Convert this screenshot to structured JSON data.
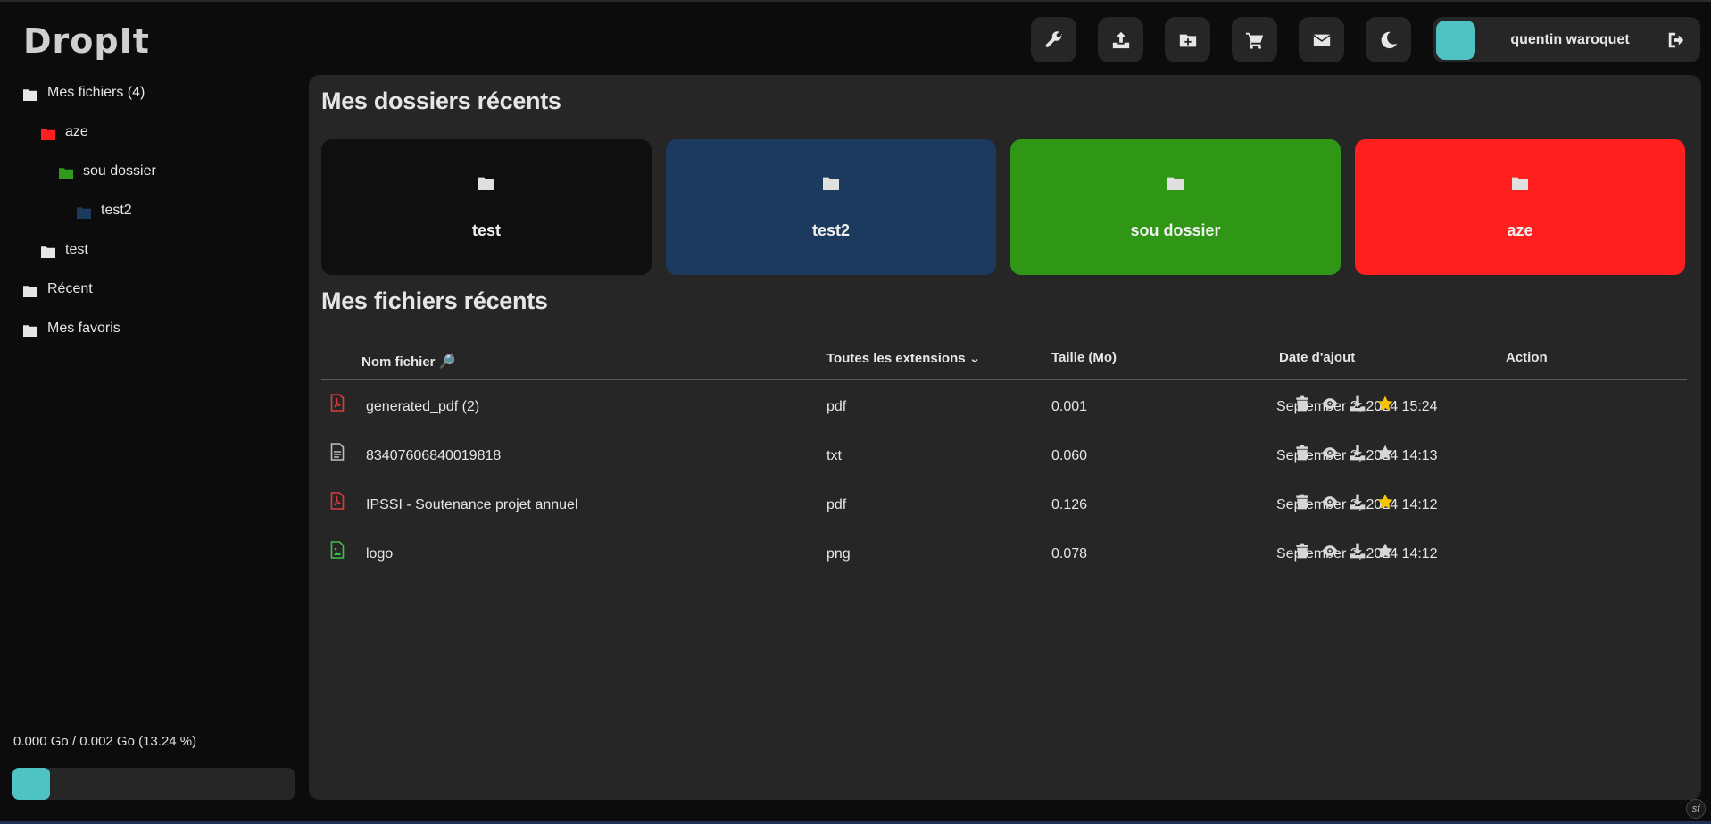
{
  "app": {
    "logo": "DropIt"
  },
  "sidebar": {
    "tree": [
      {
        "label": "Mes fichiers (4)",
        "color": "#e6e6e6",
        "indent": 0
      },
      {
        "label": "aze",
        "color": "#ff1f1f",
        "indent": 1
      },
      {
        "label": "sou dossier",
        "color": "#2f9a1b",
        "indent": 2
      },
      {
        "label": "test2",
        "color": "#1b3a5e",
        "indent": 3
      },
      {
        "label": "test",
        "color": "#e6e6e6",
        "indent": 1
      },
      {
        "label": "Récent",
        "color": "#e6e6e6",
        "indent": 0
      },
      {
        "label": "Mes favoris",
        "color": "#e6e6e6",
        "indent": 0
      }
    ],
    "storage_text": "0.000 Go / 0.002 Go (13.24 %)",
    "storage_percent": 13.24
  },
  "topbar": {
    "buttons": [
      "wrench-icon",
      "upload-icon",
      "new-folder-icon",
      "cart-icon",
      "mail-icon",
      "moon-icon"
    ],
    "username": "quentin waroquet"
  },
  "recent_folders": {
    "title": "Mes dossiers récents",
    "items": [
      {
        "label": "test",
        "color": "#0f0f0f"
      },
      {
        "label": "test2",
        "color": "#1b3a5e"
      },
      {
        "label": "sou dossier",
        "color": "#2f9616"
      },
      {
        "label": "aze",
        "color": "#ff1f1f"
      }
    ]
  },
  "recent_files": {
    "title": "Mes fichiers récents",
    "headers": {
      "name": "Nom fichier 🔎",
      "extension": "Toutes les extensions ⌄",
      "size": "Taille (Mo)",
      "date": "Date d'ajout",
      "action": "Action"
    },
    "rows": [
      {
        "name": "generated_pdf (2)",
        "ext": "pdf",
        "size": "0.001",
        "date": "September 2, 2024 15:24",
        "favorite": true,
        "icon": "pdf-file-icon",
        "icon_color": "#e03a3a"
      },
      {
        "name": "83407606840019818",
        "ext": "txt",
        "size": "0.060",
        "date": "September 2, 2024 14:13",
        "favorite": false,
        "icon": "text-file-icon",
        "icon_color": "#bdbdbd"
      },
      {
        "name": "IPSSI - Soutenance projet annuel",
        "ext": "pdf",
        "size": "0.126",
        "date": "September 2, 2024 14:12",
        "favorite": true,
        "icon": "pdf-file-icon",
        "icon_color": "#e03a3a"
      },
      {
        "name": "logo",
        "ext": "png",
        "size": "0.078",
        "date": "September 2, 2024 14:12",
        "favorite": false,
        "icon": "image-file-icon",
        "icon_color": "#3fbf4a"
      }
    ]
  },
  "colors": {
    "accent": "#4fc3c3",
    "star": "#f6c500",
    "panel": "#262626"
  },
  "footer": {
    "badge": "sf"
  }
}
